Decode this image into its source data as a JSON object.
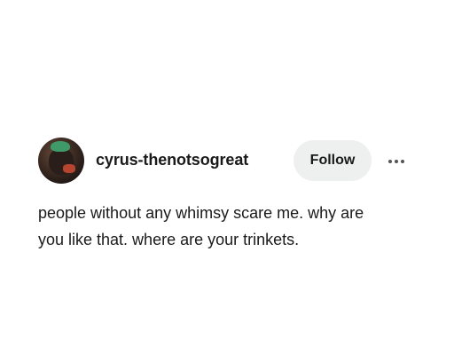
{
  "post": {
    "username": "cyrus-thenotsogreat",
    "follow_label": "Follow",
    "more_icon": "more-horizontal-icon",
    "avatar_icon": "avatar",
    "body_lines": [
      "people without any whimsy scare me. why are",
      "you like that. where are your trinkets."
    ]
  },
  "colors": {
    "background": "#ffffff",
    "text": "#1a1a1a",
    "follow_button_bg": "#eef0f0",
    "avatar_hair": "#3f9a6a"
  }
}
